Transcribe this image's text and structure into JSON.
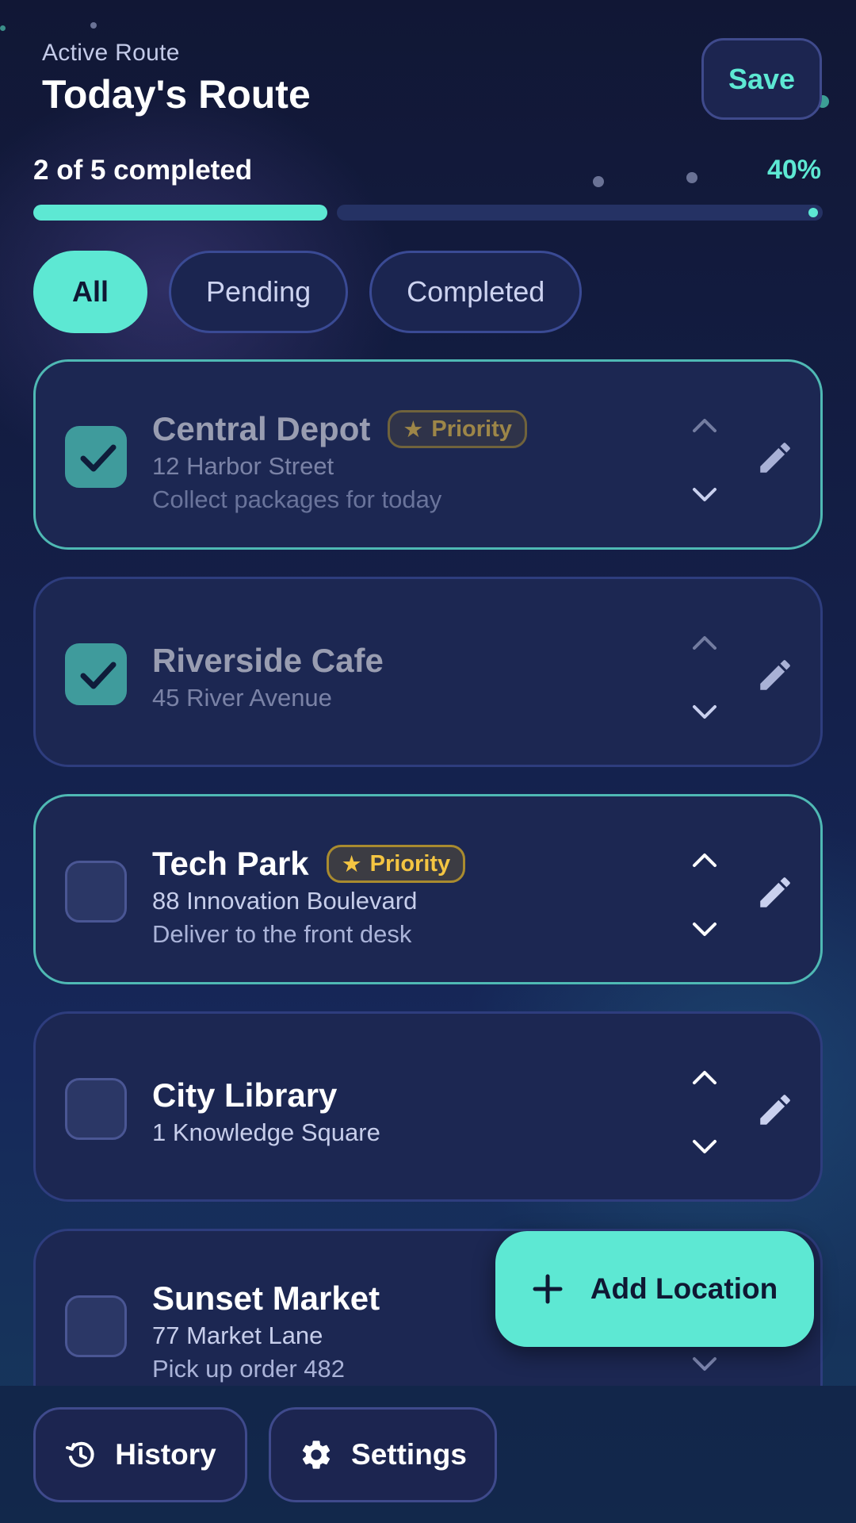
{
  "header": {
    "eyebrow": "Active Route",
    "title": "Today's Route",
    "save_label": "Save"
  },
  "progress": {
    "label": "2 of 5 completed",
    "percent_label": "40%",
    "fraction": 0.4
  },
  "filters": [
    {
      "label": "All",
      "active": true
    },
    {
      "label": "Pending",
      "active": false
    },
    {
      "label": "Completed",
      "active": false
    }
  ],
  "stops": [
    {
      "name": "Central Depot",
      "address": "12 Harbor Street",
      "note": "Collect packages for today",
      "priority": true,
      "completed": true
    },
    {
      "name": "Riverside Cafe",
      "address": "45 River Avenue",
      "note": "",
      "priority": false,
      "completed": true
    },
    {
      "name": "Tech Park",
      "address": "88 Innovation Boulevard",
      "note": "Deliver to the front desk",
      "priority": true,
      "completed": false
    },
    {
      "name": "City Library",
      "address": "1 Knowledge Square",
      "note": "",
      "priority": false,
      "completed": false
    },
    {
      "name": "Sunset Market",
      "address": "77 Market Lane",
      "note": "Pick up order 482",
      "priority": false,
      "completed": false
    }
  ],
  "badge_label": "Priority",
  "fab": {
    "label": "Add Location",
    "icon": "plus-icon"
  },
  "bottom_nav": [
    {
      "label": "History",
      "icon": "history-icon"
    },
    {
      "label": "Settings",
      "icon": "gear-icon"
    }
  ],
  "colors": {
    "accent": "#5de8d3",
    "priority": "#f4c542",
    "background": "#14204a"
  }
}
